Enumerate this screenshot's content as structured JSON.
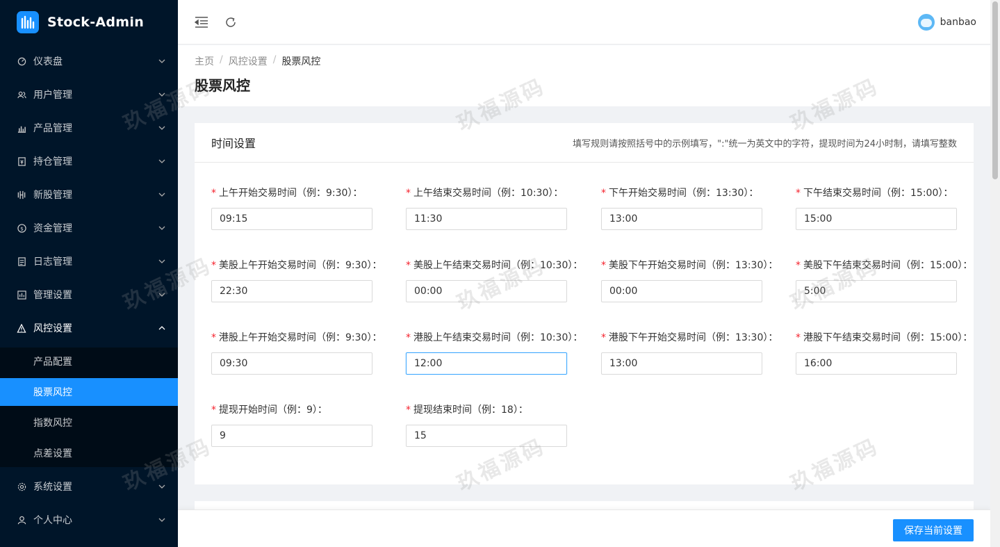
{
  "app": {
    "title": "Stock-Admin"
  },
  "sidebar": {
    "items": [
      {
        "label": "仪表盘",
        "icon": "dashboard-icon"
      },
      {
        "label": "用户管理",
        "icon": "users-icon"
      },
      {
        "label": "产品管理",
        "icon": "bar-chart-icon"
      },
      {
        "label": "持仓管理",
        "icon": "position-icon"
      },
      {
        "label": "新股管理",
        "icon": "ipo-icon"
      },
      {
        "label": "资金管理",
        "icon": "money-icon"
      },
      {
        "label": "日志管理",
        "icon": "log-icon"
      },
      {
        "label": "管理设置",
        "icon": "admin-settings-icon"
      },
      {
        "label": "风控设置",
        "icon": "warning-icon"
      },
      {
        "label": "系统设置",
        "icon": "gear-icon"
      },
      {
        "label": "个人中心",
        "icon": "user-icon"
      }
    ],
    "submenu": [
      {
        "label": "产品配置"
      },
      {
        "label": "股票风控"
      },
      {
        "label": "指数风控"
      },
      {
        "label": "点差设置"
      }
    ]
  },
  "header": {
    "user_name": "banbao"
  },
  "breadcrumb": {
    "home": "主页",
    "parent": "风控设置",
    "current": "股票风控",
    "sep": "/"
  },
  "page": {
    "title": "股票风控"
  },
  "card": {
    "title": "时间设置",
    "hint": "填写规则请按照括号中的示例填写，\":\"统一为英文中的字符，提现时间为24小时制，请填写整数",
    "fields": [
      {
        "label": "上午开始交易时间（例：9:30）：",
        "value": "09:15"
      },
      {
        "label": "上午结束交易时间（例：10:30）：",
        "value": "11:30"
      },
      {
        "label": "下午开始交易时间（例：13:30）：",
        "value": "13:00"
      },
      {
        "label": "下午结束交易时间（例：15:00）：",
        "value": "15:00"
      },
      {
        "label": "美股上午开始交易时间（例：9:30）：",
        "value": "22:30"
      },
      {
        "label": "美股上午结束交易时间（例：10:30）：",
        "value": "00:00"
      },
      {
        "label": "美股下午开始交易时间（例：13:30）：",
        "value": "00:00"
      },
      {
        "label": "美股下午结束交易时间（例：15:00）：",
        "value": "5:00"
      },
      {
        "label": "港股上午开始交易时间（例：9:30）：",
        "value": "09:30"
      },
      {
        "label": "港股上午结束交易时间（例：10:30）：",
        "value": "12:00"
      },
      {
        "label": "港股下午开始交易时间（例：13:30）：",
        "value": "13:00"
      },
      {
        "label": "港股下午结束交易时间（例：15:00）：",
        "value": "16:00"
      },
      {
        "label": "提现开始时间（例：9）：",
        "value": "9"
      },
      {
        "label": "提现结束时间（例：18）：",
        "value": "15"
      }
    ]
  },
  "footer": {
    "save_label": "保存当前设置"
  },
  "watermark": {
    "text": "玖福源码"
  },
  "colors": {
    "primary": "#1890ff",
    "sidebar_bg": "#001529",
    "required": "#f5222d"
  }
}
